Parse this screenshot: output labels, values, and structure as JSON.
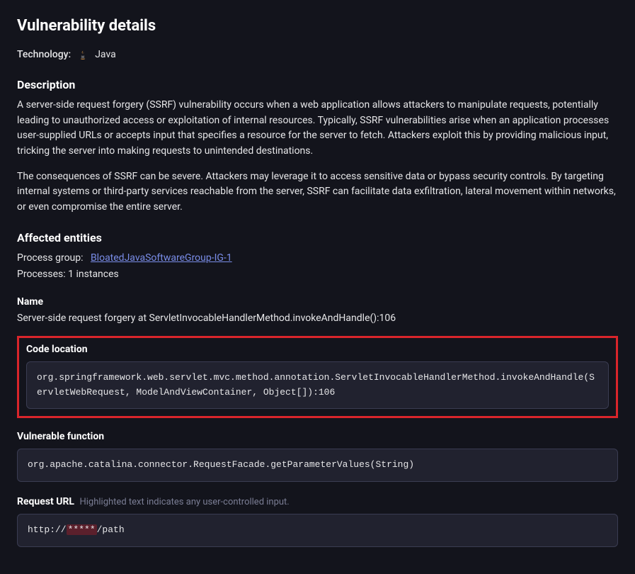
{
  "title": "Vulnerability details",
  "technology": {
    "label": "Technology:",
    "value": "Java"
  },
  "description": {
    "heading": "Description",
    "para1": "A server-side request forgery (SSRF) vulnerability occurs when a web application allows attackers to manipulate requests, potentially leading to unauthorized access or exploitation of internal resources. Typically, SSRF vulnerabilities arise when an application processes user-supplied URLs or accepts input that specifies a resource for the server to fetch. Attackers exploit this by providing malicious input, tricking the server into making requests to unintended destinations.",
    "para2": "The consequences of SSRF can be severe. Attackers may leverage it to access sensitive data or bypass security controls. By targeting internal systems or third-party services reachable from the server, SSRF can facilitate data exfiltration, lateral movement within networks, or even compromise the entire server."
  },
  "affected": {
    "heading": "Affected entities",
    "process_group_label": "Process group:",
    "process_group_link": "BloatedJavaSoftwareGroup-IG-1",
    "processes_label": "Processes:",
    "processes_value": "1 instances"
  },
  "name": {
    "heading": "Name",
    "value": "Server-side request forgery at ServletInvocableHandlerMethod.invokeAndHandle():106"
  },
  "code_location": {
    "label": "Code location",
    "value": "org.springframework.web.servlet.mvc.method.annotation.ServletInvocableHandlerMethod.invokeAndHandle(ServletWebRequest, ModelAndViewContainer, Object[]):106"
  },
  "vulnerable_function": {
    "label": "Vulnerable function",
    "value": "org.apache.catalina.connector.RequestFacade.getParameterValues(String)"
  },
  "request_url": {
    "label": "Request URL",
    "hint": "Highlighted text indicates any user-controlled input.",
    "prefix": "http://",
    "masked": "*****",
    "suffix": "/path"
  }
}
